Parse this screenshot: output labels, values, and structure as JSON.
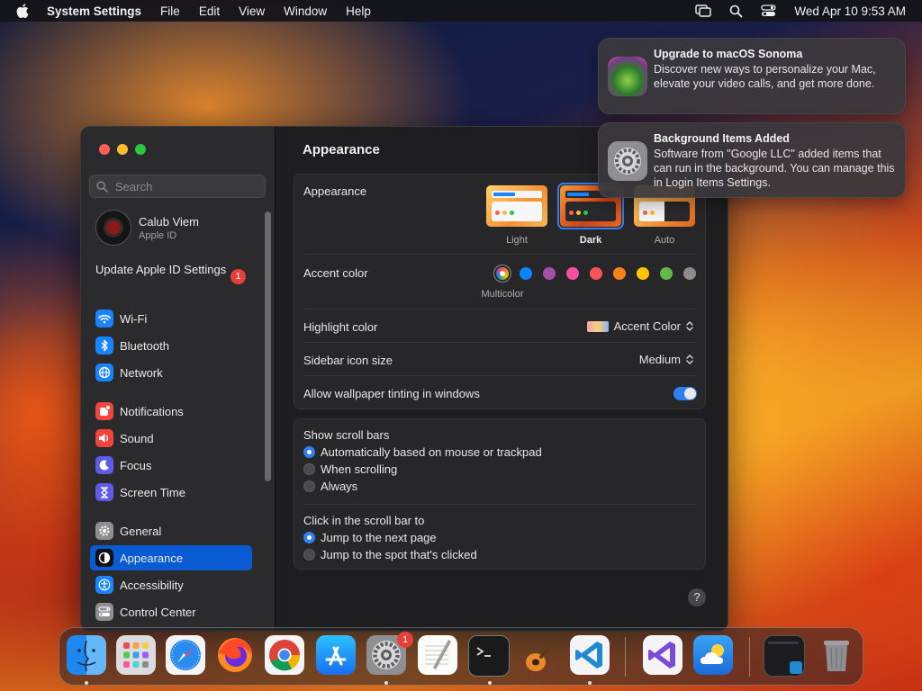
{
  "menubar": {
    "app_name": "System Settings",
    "menus": [
      "File",
      "Edit",
      "View",
      "Window"
    ],
    "help": "Help",
    "datetime": "Wed Apr 10  9:53 AM"
  },
  "sidebar": {
    "search_placeholder": "Search",
    "profile": {
      "name": "Calub Viem",
      "sub": "Apple ID"
    },
    "update_label": "Update Apple ID Settings",
    "update_badge": "1",
    "items": {
      "wifi": "Wi-Fi",
      "bluetooth": "Bluetooth",
      "network": "Network",
      "notifications": "Notifications",
      "sound": "Sound",
      "focus": "Focus",
      "screen_time": "Screen Time",
      "general": "General",
      "appearance": "Appearance",
      "accessibility": "Accessibility",
      "control_center": "Control Center"
    }
  },
  "main": {
    "title": "Appearance",
    "appearance_label": "Appearance",
    "modes": {
      "light": "Light",
      "dark": "Dark",
      "auto": "Auto"
    },
    "selected_mode": "Dark",
    "accent_label": "Accent color",
    "accent_selected": "Multicolor",
    "accent_colors": [
      "#0a84ff",
      "#a550a7",
      "#f74f9e",
      "#ff5257",
      "#f7821b",
      "#ffc600",
      "#62ba46",
      "#8c8c8c"
    ],
    "highlight_label": "Highlight color",
    "highlight_value": "Accent Color",
    "sidebar_icon_label": "Sidebar icon size",
    "sidebar_icon_value": "Medium",
    "tinting_label": "Allow wallpaper tinting in windows",
    "tinting_on": true,
    "scroll_bars_label": "Show scroll bars",
    "scroll_options": [
      "Automatically based on mouse or trackpad",
      "When scrolling",
      "Always"
    ],
    "scroll_selected": 0,
    "click_label": "Click in the scroll bar to",
    "click_options": [
      "Jump to the next page",
      "Jump to the spot that's clicked"
    ],
    "click_selected": 0,
    "help": "?"
  },
  "notifications": [
    {
      "title": "Upgrade to macOS Sonoma",
      "body": "Discover new ways to personalize your Mac, elevate your video calls, and get more done."
    },
    {
      "title": "Background Items Added",
      "body": "Software from \"Google LLC\" added items that can run in the background. You can manage this in Login Items Settings."
    }
  ],
  "dock": {
    "settings_badge": "1"
  }
}
